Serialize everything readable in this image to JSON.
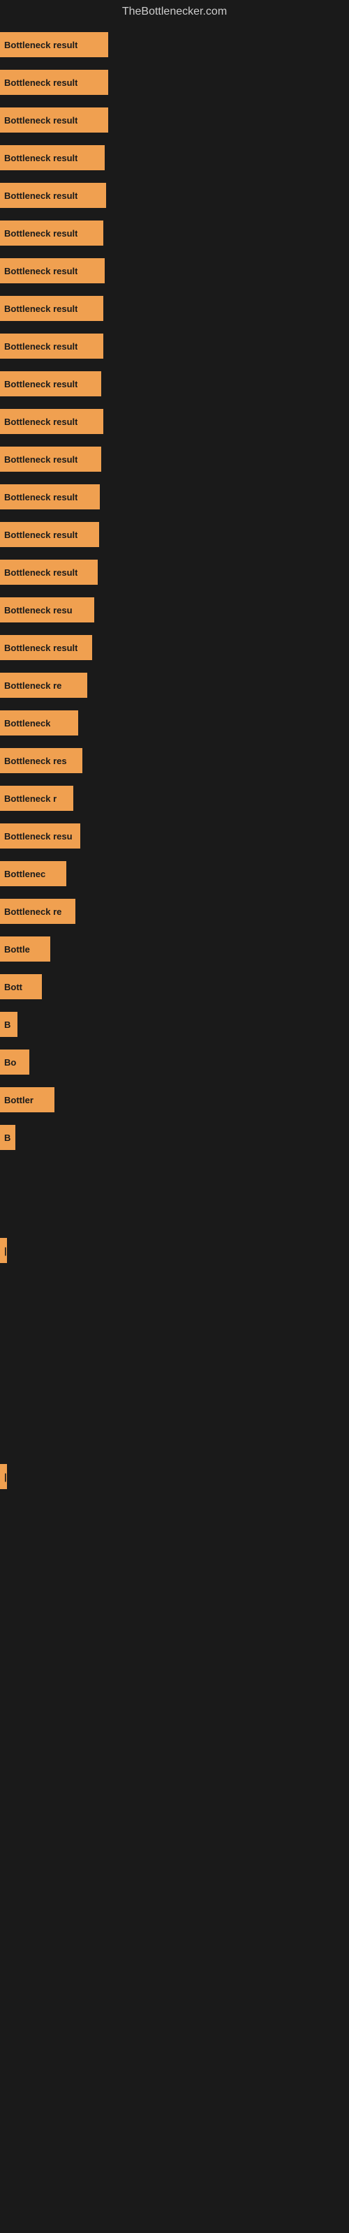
{
  "site_title": "TheBottlenecker.com",
  "bars": [
    {
      "label": "Bottleneck result",
      "width": 155,
      "visible_label": "Bottleneck result"
    },
    {
      "label": "Bottleneck result",
      "width": 155,
      "visible_label": "Bottleneck result"
    },
    {
      "label": "Bottleneck result",
      "width": 155,
      "visible_label": "Bottleneck result"
    },
    {
      "label": "Bottleneck result",
      "width": 150,
      "visible_label": "Bottleneck result"
    },
    {
      "label": "Bottleneck result",
      "width": 152,
      "visible_label": "Bottleneck result"
    },
    {
      "label": "Bottleneck result",
      "width": 148,
      "visible_label": "Bottleneck result"
    },
    {
      "label": "Bottleneck result",
      "width": 150,
      "visible_label": "Bottleneck result"
    },
    {
      "label": "Bottleneck result",
      "width": 148,
      "visible_label": "Bottleneck result"
    },
    {
      "label": "Bottleneck result",
      "width": 148,
      "visible_label": "Bottleneck result"
    },
    {
      "label": "Bottleneck result",
      "width": 145,
      "visible_label": "Bottleneck result"
    },
    {
      "label": "Bottleneck result",
      "width": 148,
      "visible_label": "Bottleneck result"
    },
    {
      "label": "Bottleneck result",
      "width": 145,
      "visible_label": "Bottleneck result"
    },
    {
      "label": "Bottleneck result",
      "width": 143,
      "visible_label": "Bottleneck result"
    },
    {
      "label": "Bottleneck result",
      "width": 142,
      "visible_label": "Bottleneck result"
    },
    {
      "label": "Bottleneck result",
      "width": 140,
      "visible_label": "Bottleneck result"
    },
    {
      "label": "Bottleneck result",
      "width": 135,
      "visible_label": "Bottleneck resu"
    },
    {
      "label": "Bottleneck result",
      "width": 132,
      "visible_label": "Bottleneck result"
    },
    {
      "label": "Bottleneck result",
      "width": 125,
      "visible_label": "Bottleneck re"
    },
    {
      "label": "Bottleneck",
      "width": 112,
      "visible_label": "Bottleneck"
    },
    {
      "label": "Bottleneck result",
      "width": 118,
      "visible_label": "Bottleneck res"
    },
    {
      "label": "Bottleneck r",
      "width": 105,
      "visible_label": "Bottleneck r"
    },
    {
      "label": "Bottleneck result",
      "width": 115,
      "visible_label": "Bottleneck resu"
    },
    {
      "label": "Bottleneck",
      "width": 95,
      "visible_label": "Bottlenec"
    },
    {
      "label": "Bottleneck result",
      "width": 108,
      "visible_label": "Bottleneck re"
    },
    {
      "label": "Bottle",
      "width": 72,
      "visible_label": "Bottle"
    },
    {
      "label": "Bott",
      "width": 60,
      "visible_label": "Bott"
    },
    {
      "label": "B",
      "width": 25,
      "visible_label": "B"
    },
    {
      "label": "Bo",
      "width": 42,
      "visible_label": "Bo"
    },
    {
      "label": "Bottler",
      "width": 78,
      "visible_label": "Bottler"
    },
    {
      "label": "B",
      "width": 22,
      "visible_label": "B"
    },
    {
      "label": "",
      "width": 0,
      "visible_label": ""
    },
    {
      "label": "",
      "width": 0,
      "visible_label": ""
    },
    {
      "label": "|",
      "width": 8,
      "visible_label": "|"
    },
    {
      "label": "",
      "width": 0,
      "visible_label": ""
    },
    {
      "label": "",
      "width": 0,
      "visible_label": ""
    },
    {
      "label": "",
      "width": 0,
      "visible_label": ""
    },
    {
      "label": "",
      "width": 0,
      "visible_label": ""
    },
    {
      "label": "",
      "width": 0,
      "visible_label": ""
    },
    {
      "label": "|",
      "width": 8,
      "visible_label": "|"
    }
  ]
}
